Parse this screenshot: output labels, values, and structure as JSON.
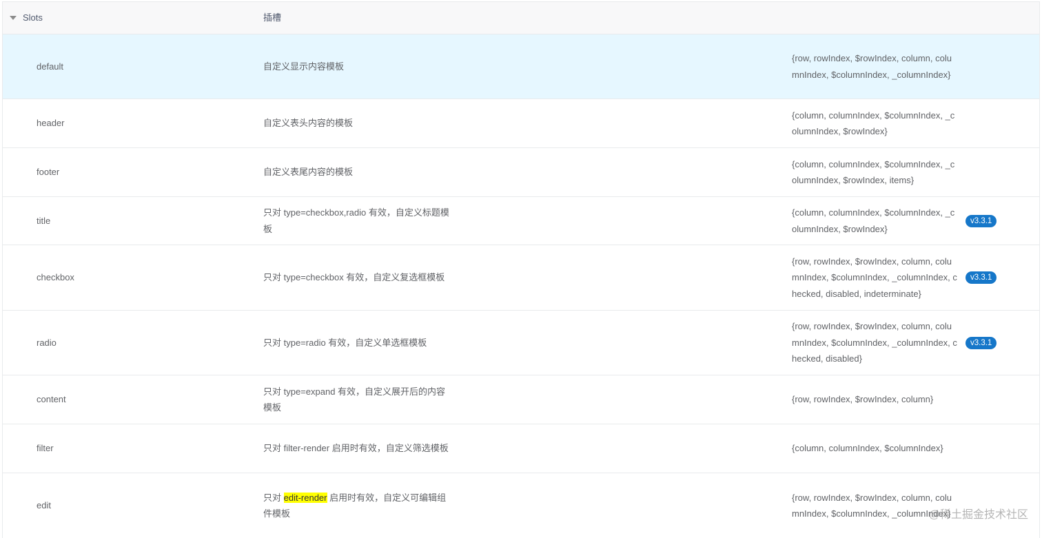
{
  "header": {
    "section_label": "Slots",
    "description_header": "插槽"
  },
  "rows": [
    {
      "name": "default",
      "desc": "自定义显示内容模板",
      "params": "{row, rowIndex, $rowIndex, column, columnIndex, $columnIndex, _columnIndex}",
      "version": ""
    },
    {
      "name": "header",
      "desc": "自定义表头内容的模板",
      "params": "{column, columnIndex, $columnIndex, _columnIndex, $rowIndex}",
      "version": ""
    },
    {
      "name": "footer",
      "desc": "自定义表尾内容的模板",
      "params": "{column, columnIndex, $columnIndex, _columnIndex, $rowIndex, items}",
      "version": ""
    },
    {
      "name": "title",
      "desc": "只对 type=checkbox,radio 有效，自定义标题模板",
      "params": "{column, columnIndex, $columnIndex, _columnIndex, $rowIndex}",
      "version": "v3.3.1"
    },
    {
      "name": "checkbox",
      "desc": "只对 type=checkbox 有效，自定义复选框模板",
      "params": "{row, rowIndex, $rowIndex, column, columnIndex, $columnIndex, _columnIndex, checked, disabled, indeterminate}",
      "version": "v3.3.1"
    },
    {
      "name": "radio",
      "desc": "只对 type=radio 有效，自定义单选框模板",
      "params": "{row, rowIndex, $rowIndex, column, columnIndex, $columnIndex, _columnIndex, checked, disabled}",
      "version": "v3.3.1"
    },
    {
      "name": "content",
      "desc": "只对 type=expand 有效，自定义展开后的内容模板",
      "params": "{row, rowIndex, $rowIndex, column}",
      "version": ""
    },
    {
      "name": "filter",
      "desc": "只对 filter-render 启用时有效，自定义筛选模板",
      "params": "{column, columnIndex, $columnIndex}",
      "version": ""
    },
    {
      "name": "edit",
      "desc_prefix": "只对 ",
      "desc_highlight": "edit-render",
      "desc_suffix": " 启用时有效，自定义可编辑组件模板",
      "params": "{row, rowIndex, $rowIndex, column, columnIndex, $columnIndex, _columnIndex}",
      "version": ""
    }
  ],
  "watermark": "@稀土掘金技术社区",
  "colors": {
    "highlight_row": "#e6f7ff",
    "badge": "#1677c9",
    "text_highlight": "#ffff00"
  }
}
